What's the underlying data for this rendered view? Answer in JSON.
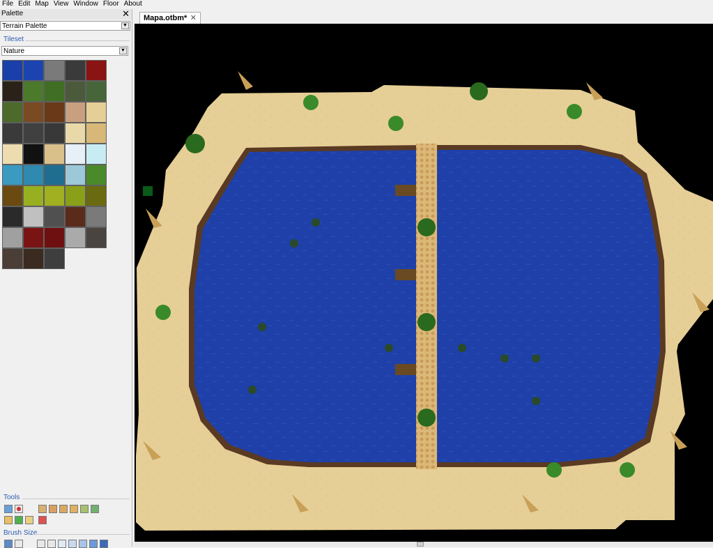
{
  "menu": [
    "File",
    "Edit",
    "Map",
    "View",
    "Window",
    "Floor",
    "About"
  ],
  "palette": {
    "title": "Palette",
    "close_glyph": "✕",
    "palette_type": "Terrain Palette",
    "tileset_label": "Tileset",
    "tileset_value": "Nature",
    "tiles": [
      {
        "name": "water-deep-tile",
        "color": "#1a3fa8"
      },
      {
        "name": "water-tile",
        "color": "#1c44b0"
      },
      {
        "name": "stone-floor-tile",
        "color": "#7a7a7a"
      },
      {
        "name": "stairs-tile",
        "color": "#3a3a3a"
      },
      {
        "name": "red-carpet-tile",
        "color": "#8a1414"
      },
      {
        "name": "wooden-stairs-tile",
        "color": "#2a2218"
      },
      {
        "name": "grass-tile",
        "color": "#4a7a2a"
      },
      {
        "name": "grass-dark-tile",
        "color": "#3f6e24"
      },
      {
        "name": "rock-grass-tile",
        "color": "#4a5a3a"
      },
      {
        "name": "rock-grass-2-tile",
        "color": "#46663a"
      },
      {
        "name": "swamp-tile",
        "color": "#4c6a2a"
      },
      {
        "name": "dirt-tile",
        "color": "#7a4a22"
      },
      {
        "name": "mud-tile",
        "color": "#6a3a18"
      },
      {
        "name": "dry-earth-tile",
        "color": "#c8a080"
      },
      {
        "name": "sand-tile",
        "color": "#e6cf96"
      },
      {
        "name": "boulder-tile",
        "color": "#3a3a3a"
      },
      {
        "name": "boulder-2-tile",
        "color": "#404040"
      },
      {
        "name": "boulder-3-tile",
        "color": "#383838"
      },
      {
        "name": "light-sand-tile",
        "color": "#e9d8a8"
      },
      {
        "name": "gravel-tile",
        "color": "#d8b878"
      },
      {
        "name": "pale-sand-tile",
        "color": "#ecdcb0"
      },
      {
        "name": "hole-tile",
        "color": "#111111"
      },
      {
        "name": "sand-pit-tile",
        "color": "#d9c08a"
      },
      {
        "name": "snow-tile",
        "color": "#e6f0f6"
      },
      {
        "name": "ice-tile",
        "color": "#c8ecf4"
      },
      {
        "name": "crystal-tile",
        "color": "#3a9ac0"
      },
      {
        "name": "crystal-2-tile",
        "color": "#2f8ab0"
      },
      {
        "name": "ice-crystal-tile",
        "color": "#1f6e90"
      },
      {
        "name": "frost-tile",
        "color": "#9cc8d8"
      },
      {
        "name": "moss-tile",
        "color": "#4a8a2a"
      },
      {
        "name": "brown-earth-tile",
        "color": "#6a4a10"
      },
      {
        "name": "lime-grass-tile",
        "color": "#98b020"
      },
      {
        "name": "yellow-grass-tile",
        "color": "#a0b020"
      },
      {
        "name": "olive-grass-tile",
        "color": "#8aa018"
      },
      {
        "name": "olive-dark-tile",
        "color": "#6a6a10"
      },
      {
        "name": "dark-rock-tile",
        "color": "#2a2a2a"
      },
      {
        "name": "marble-tile",
        "color": "#c0c0c0"
      },
      {
        "name": "rubble-tile",
        "color": "#505050"
      },
      {
        "name": "lava-rock-tile",
        "color": "#5a2a1a"
      },
      {
        "name": "grey-rock-tile",
        "color": "#7a7a7a"
      },
      {
        "name": "concrete-tile",
        "color": "#a0a0a0"
      },
      {
        "name": "red-floor-tile",
        "color": "#7a1414"
      },
      {
        "name": "red-floor-2-tile",
        "color": "#6e1010"
      },
      {
        "name": "pebble-tile",
        "color": "#aaaaaa"
      },
      {
        "name": "dark-stone-tile",
        "color": "#4a4440"
      },
      {
        "name": "ash-tile",
        "color": "#4a3e36"
      },
      {
        "name": "cave-tile",
        "color": "#3a2a20"
      },
      {
        "name": "shadow-tile",
        "color": "#3e3e3e"
      }
    ],
    "tools_label": "Tools",
    "brush_size_label": "Brush Size"
  },
  "tab": {
    "label": "Mapa.otbm*",
    "close_glyph": "✕"
  },
  "colors": {
    "water": "#1e3fa6",
    "sand": "#e6cf96",
    "void": "#000000",
    "bridge": "#d8b878",
    "shore": "#5a3a22"
  }
}
